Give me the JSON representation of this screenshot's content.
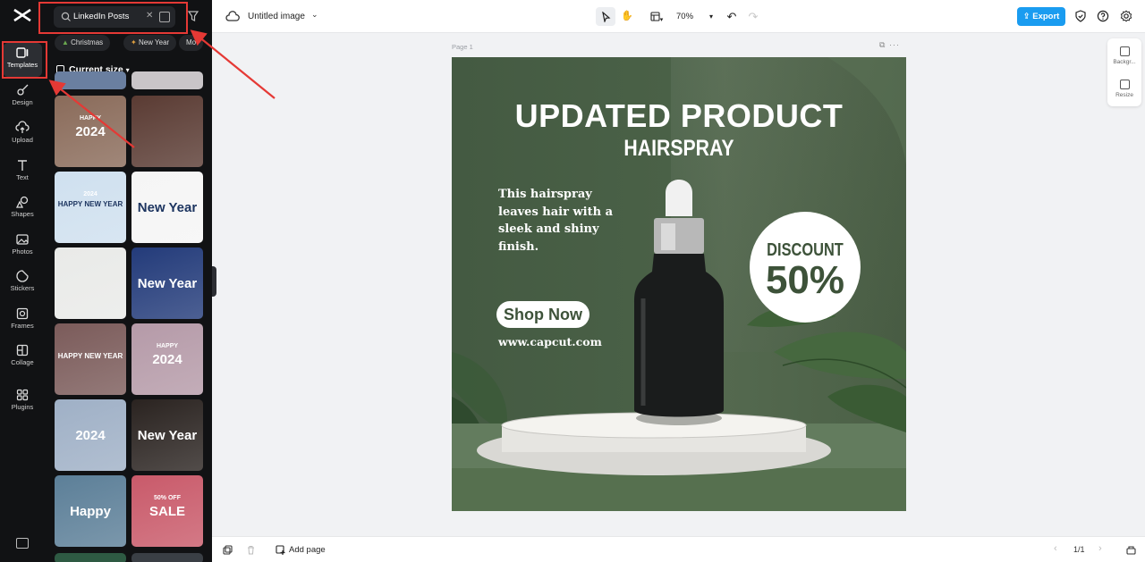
{
  "rail": {
    "items": [
      {
        "label": "Templates",
        "icon": "templates-icon"
      },
      {
        "label": "Design",
        "icon": "design-icon"
      },
      {
        "label": "Upload",
        "icon": "upload-icon"
      },
      {
        "label": "Text",
        "icon": "text-icon"
      },
      {
        "label": "Shapes",
        "icon": "shapes-icon"
      },
      {
        "label": "Photos",
        "icon": "photos-icon"
      },
      {
        "label": "Stickers",
        "icon": "stickers-icon"
      },
      {
        "label": "Frames",
        "icon": "frames-icon"
      },
      {
        "label": "Collage",
        "icon": "collage-icon"
      },
      {
        "label": "Plugins",
        "icon": "plugins-icon"
      }
    ]
  },
  "panel": {
    "search_value": "LinkedIn Posts",
    "chips": [
      "Christmas",
      "New Year",
      "Mo"
    ],
    "size_label": "Current size",
    "thumbs": [
      {
        "text": "2024",
        "sub": "HAPPY",
        "bg": "#8a6b5a"
      },
      {
        "text": "",
        "sub": "",
        "bg": "#5a3b33"
      },
      {
        "text": "HAPPY NEW YEAR",
        "sub": "2024",
        "bg": "#cfe0ef"
      },
      {
        "text": "New Year",
        "sub": "",
        "bg": "#f5f5f5"
      },
      {
        "text": "",
        "sub": "",
        "bg": "#e9eae8"
      },
      {
        "text": "New Year",
        "sub": "",
        "bg": "#233b7a"
      },
      {
        "text": "HAPPY NEW YEAR",
        "sub": "",
        "bg": "#7b5b5a"
      },
      {
        "text": "2024",
        "sub": "HAPPY",
        "bg": "#b59aa8"
      },
      {
        "text": "2024",
        "sub": "",
        "bg": "#9fb0c6"
      },
      {
        "text": "New Year",
        "sub": "",
        "bg": "#2a2320"
      },
      {
        "text": "Happy",
        "sub": "",
        "bg": "#5c7f98"
      },
      {
        "text": "SALE",
        "sub": "50% OFF",
        "bg": "#c95a6a"
      }
    ]
  },
  "topbar": {
    "title": "Untitled image",
    "zoom": "70%",
    "export_label": "Export"
  },
  "canvas": {
    "page_label": "Page 1",
    "design": {
      "title": "UPDATED PRODUCT",
      "subtitle": "HAIRSPRAY",
      "description": "This hairspray leaves hair with a sleek and shiny finish.",
      "shop_label": "Shop Now",
      "url": "www.capcut.com",
      "discount_label": "DISCOUNT",
      "discount_value": "50%"
    }
  },
  "side_tools": [
    {
      "label": "Backgr..."
    },
    {
      "label": "Resize"
    }
  ],
  "bottombar": {
    "add_page": "Add page",
    "pages": "1/1"
  },
  "colors": {
    "accent": "#1a9cf0",
    "annotation": "#e53935",
    "design_green": "#4a6147"
  }
}
